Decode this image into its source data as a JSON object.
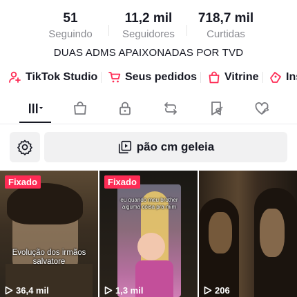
{
  "stats": [
    {
      "value": "51",
      "label": "Seguindo"
    },
    {
      "value": "11,2 mil",
      "label": "Seguidores"
    },
    {
      "value": "718,7 mil",
      "label": "Curtidas"
    }
  ],
  "bio": "DUAS ADMS APAIXONADAS POR TVD",
  "links": [
    {
      "label": "TikTok Studio",
      "icon": "user-plus-icon"
    },
    {
      "label": "Seus pedidos",
      "icon": "cart-icon"
    },
    {
      "label": "Vitrine",
      "icon": "shopping-bag-icon"
    },
    {
      "label": "Ins",
      "icon": "inspiration-icon"
    }
  ],
  "tabs": [
    {
      "icon": "grid-menu-icon",
      "active": true
    },
    {
      "icon": "shopping-bag-icon"
    },
    {
      "icon": "lock-icon"
    },
    {
      "icon": "repost-icon"
    },
    {
      "icon": "bookmark-eye-icon"
    },
    {
      "icon": "liked-heart-icon"
    }
  ],
  "collection": {
    "label": "pão cm geleia",
    "icon": "playlist-icon"
  },
  "settings_icon": "gear-icon",
  "videos": [
    {
      "pinned_label": "Fixado",
      "views": "36,4 mil",
      "caption": "Evolução dos irmãos salvatore"
    },
    {
      "pinned_label": "Fixado",
      "views": "1,3 mil",
      "caption": "eu quando meu brother alguma coisa pra mim"
    },
    {
      "views": "206"
    }
  ],
  "colors": {
    "accent": "#fe2c55",
    "text": "#161823",
    "muted": "#8a8b91"
  }
}
